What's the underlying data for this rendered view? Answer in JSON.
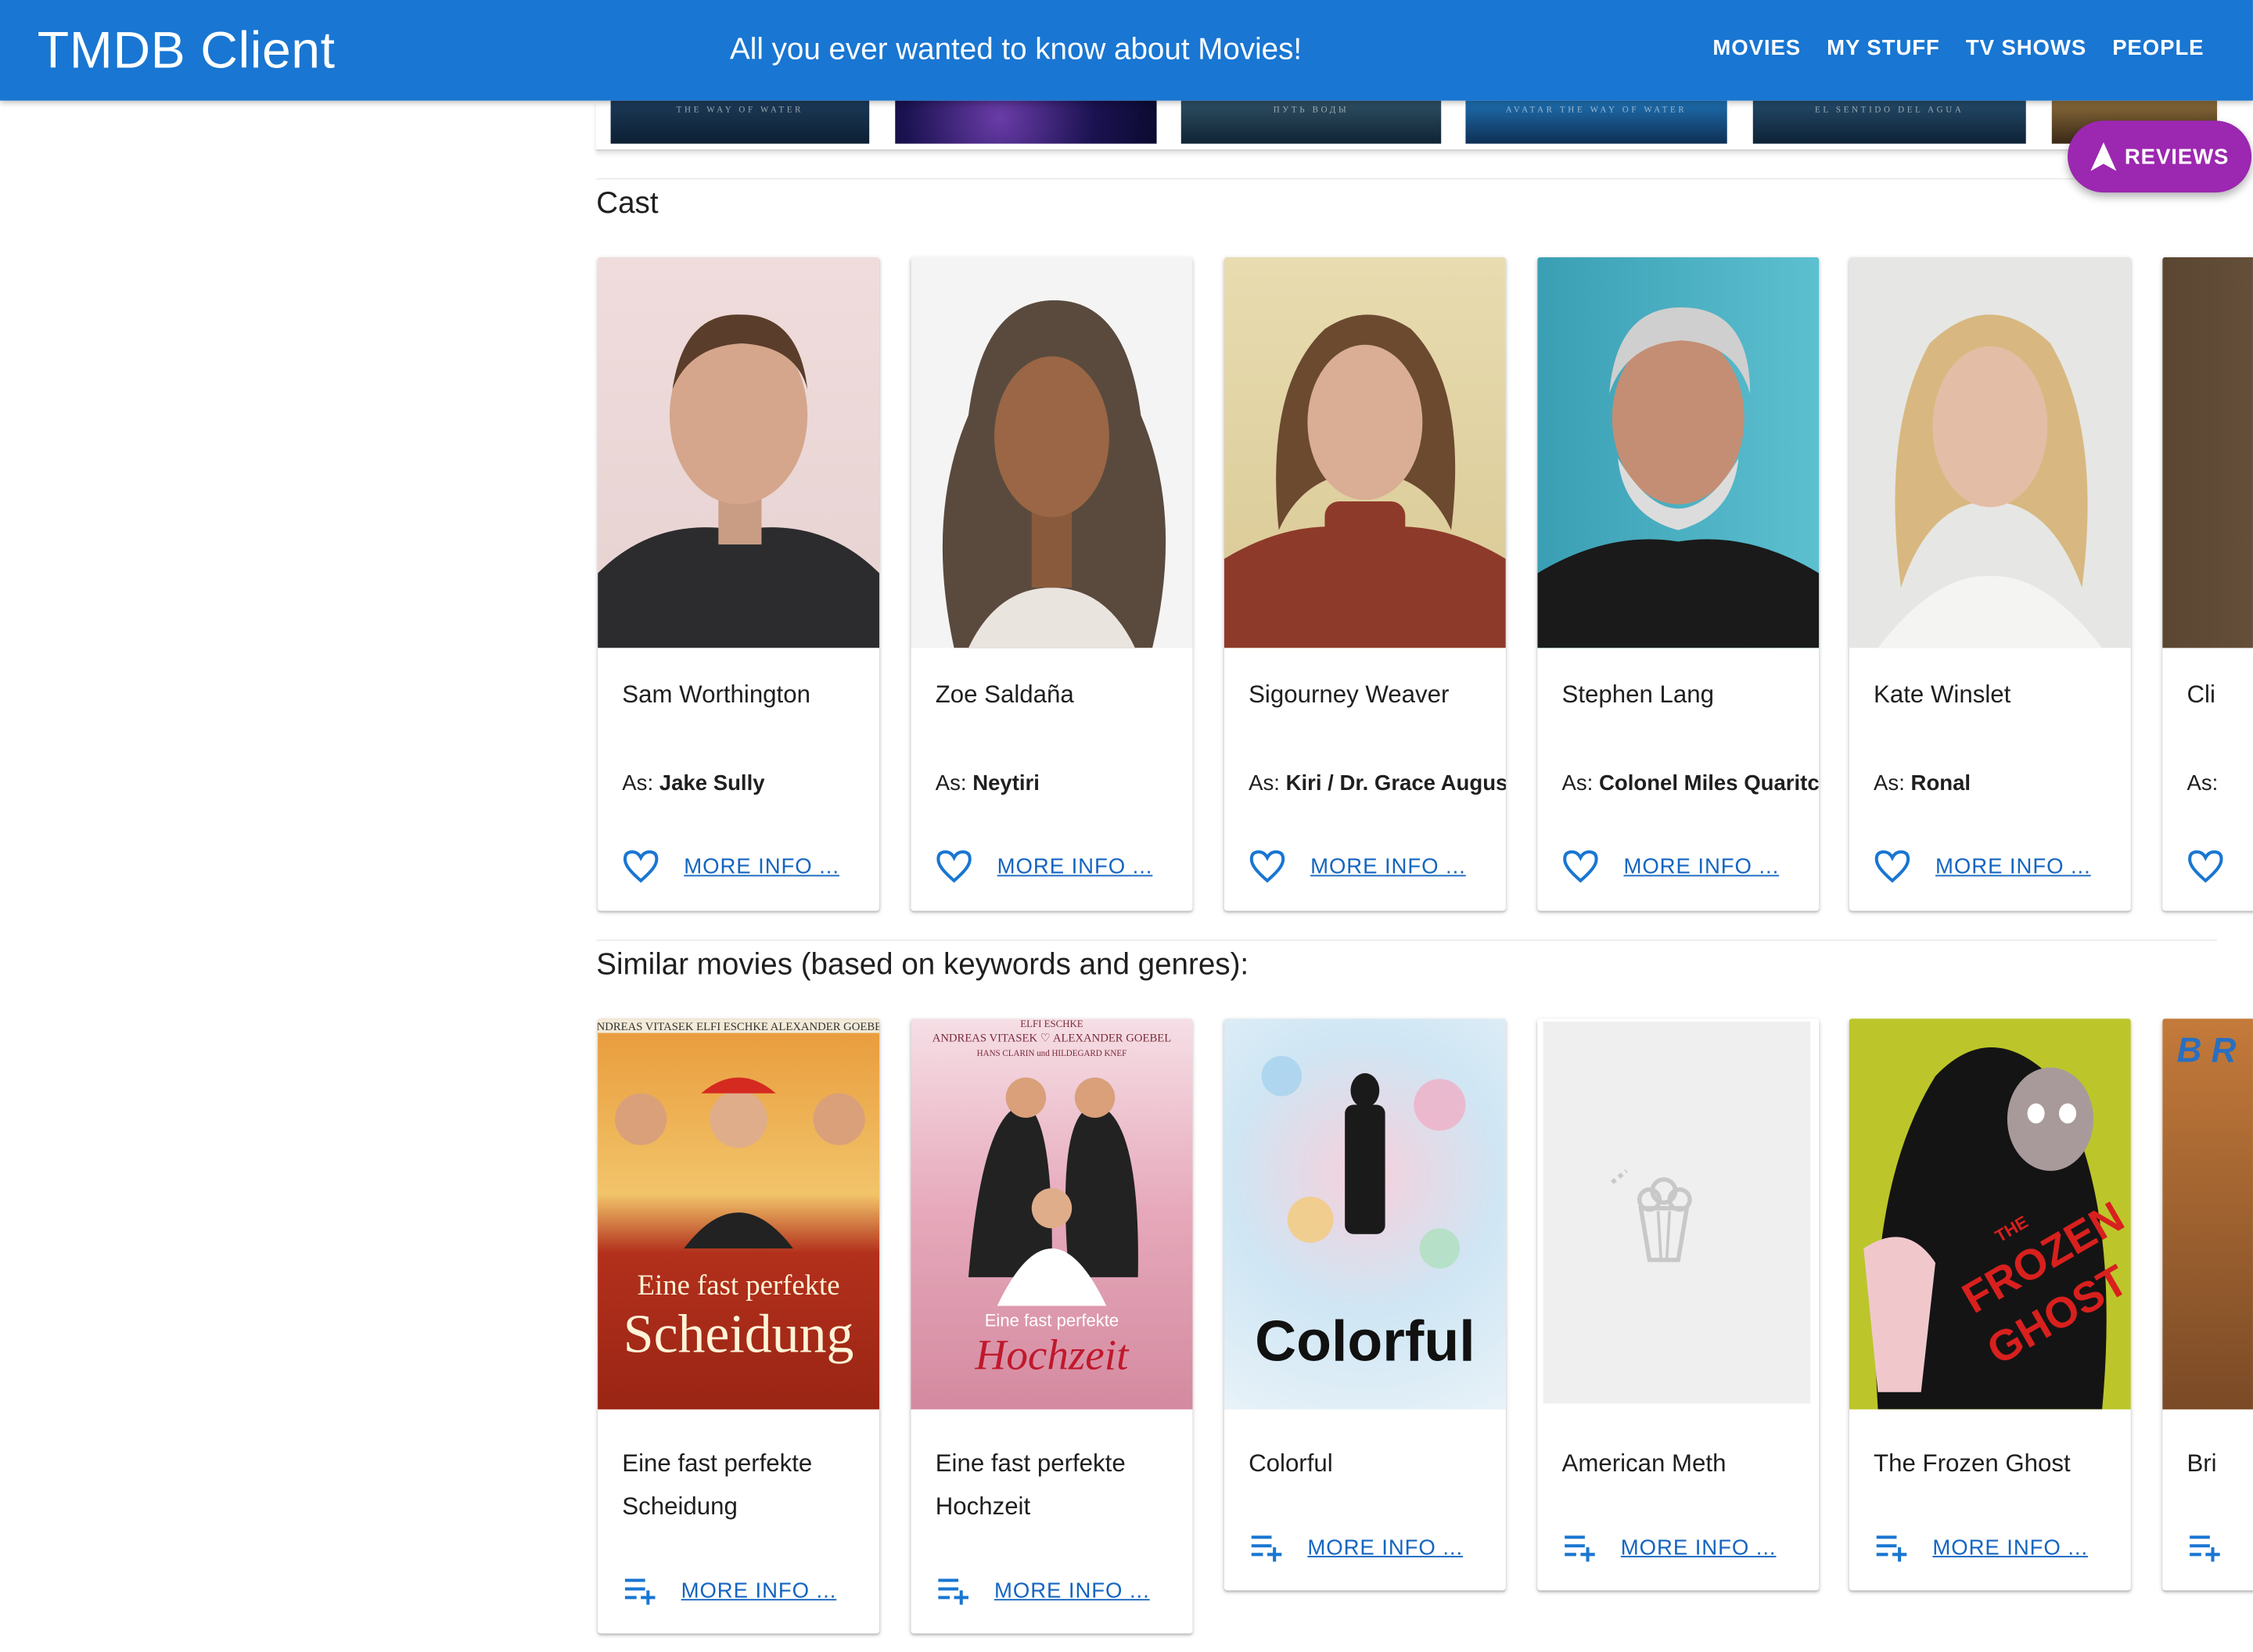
{
  "header": {
    "brand": "TMDB Client",
    "tagline": "All you ever wanted to know about Movies!",
    "nav": [
      "MOVIES",
      "MY STUFF",
      "TV SHOWS",
      "PEOPLE"
    ]
  },
  "backdrops": [
    {
      "text": "THE WAY OF WATER"
    },
    {
      "text": ""
    },
    {
      "text": "ПУТЬ ВОДЫ"
    },
    {
      "text": "AVATAR THE WAY OF WATER"
    },
    {
      "text": "EL SENTIDO DEL AGUA"
    },
    {
      "text": ""
    }
  ],
  "fab": {
    "label": "REVIEWS",
    "icon": "navigation-icon"
  },
  "cast": {
    "title": "Cast",
    "as_prefix": "As:",
    "more_label": "MORE INFO ...",
    "items": [
      {
        "name": "Sam Worthington",
        "role": "Jake Sully"
      },
      {
        "name": "Zoe Saldaña",
        "role": "Neytiri"
      },
      {
        "name": "Sigourney Weaver",
        "role": "Kiri / Dr. Grace August"
      },
      {
        "name": "Stephen Lang",
        "role": "Colonel Miles Quaritch"
      },
      {
        "name": "Kate Winslet",
        "role": "Ronal"
      },
      {
        "name": "Cli",
        "role": ""
      }
    ]
  },
  "similar": {
    "title": "Similar movies (based on keywords and genres):",
    "more_label": "MORE INFO ...",
    "items": [
      {
        "title": "Eine fast perfekte Scheidung"
      },
      {
        "title": "Eine fast perfekte Hochzeit"
      },
      {
        "title": "Colorful"
      },
      {
        "title": "American Meth"
      },
      {
        "title": "The Frozen Ghost"
      },
      {
        "title": "Bri"
      }
    ]
  },
  "posters": {
    "scheidung": {
      "top": "ANDREAS VITASEK   ELFI ESCHKE   ALEXANDER GOEBEL",
      "line1": "Eine fast perfekte",
      "line2": "Scheidung"
    },
    "hochzeit": {
      "top1": "ELFI ESCHKE",
      "top2": "ANDREAS VITASEK ♡ ALEXANDER GOEBEL",
      "top3": "HANS CLARIN und HILDEGARD KNEF",
      "line1": "Eine fast perfekte",
      "line2": "Hochzeit"
    },
    "colorful": {
      "text": "Colorful"
    },
    "frozen": {
      "line1": "THE",
      "line2": "FROZEN",
      "line3": "GHOST"
    },
    "bri": {
      "text": "B R"
    }
  },
  "colors": {
    "primary": "#1976d2",
    "accent": "#9c27b0",
    "link": "#1565c0"
  }
}
